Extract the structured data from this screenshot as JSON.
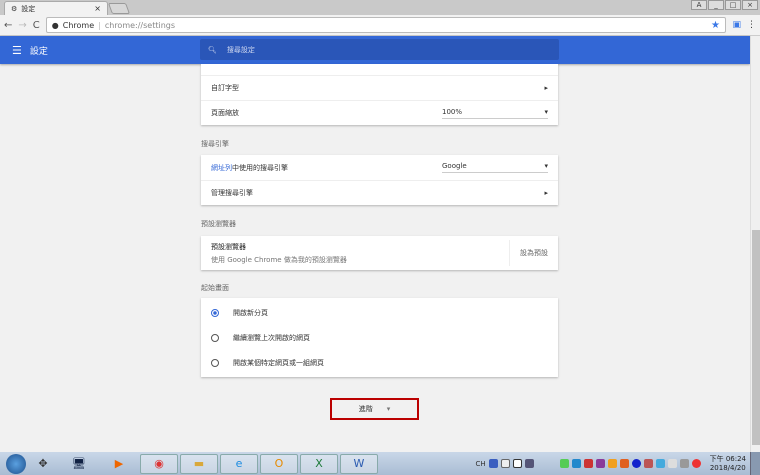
{
  "browser": {
    "tab_title": "設定",
    "tab_close": "×",
    "omnibox_site": "Chrome",
    "omnibox_url": "chrome://settings",
    "window_buttons": [
      "A",
      "_",
      "□",
      "×"
    ]
  },
  "header": {
    "title": "設定",
    "search_placeholder": "搜尋設定"
  },
  "appearance": {
    "custom_fonts": "自訂字型",
    "page_zoom_label": "頁面縮放",
    "page_zoom_value": "100%"
  },
  "search_engine": {
    "section": "搜尋引擎",
    "address_bar_link": "網址列",
    "address_bar_rest": "中使用的搜尋引擎",
    "engine_value": "Google",
    "manage": "管理搜尋引擎"
  },
  "default_browser": {
    "section": "預設瀏覽器",
    "title": "預設瀏覽器",
    "subtitle": "使用 Google Chrome 做為我的預設瀏覽器",
    "button": "設為預設"
  },
  "startup": {
    "section": "起始畫面",
    "options": [
      {
        "label": "開啟新分頁",
        "selected": true
      },
      {
        "label": "繼續瀏覽上次開啟的網頁",
        "selected": false
      },
      {
        "label": "開啟某個特定網頁或一組網頁",
        "selected": false
      }
    ]
  },
  "advanced": {
    "label": "進階"
  },
  "taskbar": {
    "lang": "CH",
    "time": "下午 06:24",
    "date": "2018/4/20"
  },
  "colors": {
    "accent": "#3367d6",
    "highlight_border": "#bb0000"
  }
}
